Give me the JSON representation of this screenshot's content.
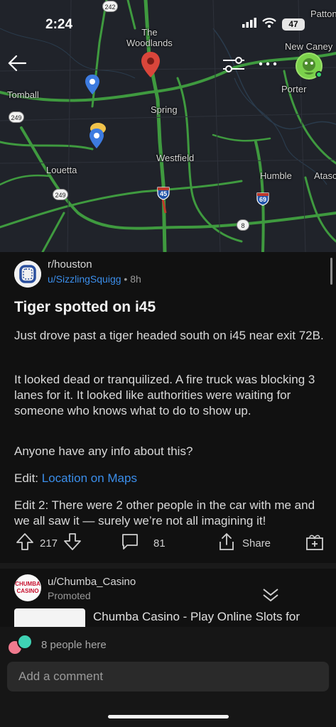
{
  "status_bar": {
    "time": "2:24",
    "battery": "47"
  },
  "map": {
    "labels": {
      "the_woodlands": "The\nWoodlands",
      "new_caney": "New Caney",
      "patton": "Patton",
      "tomball": "Tomball",
      "porter": "Porter",
      "spring": "Spring",
      "westfield": "Westfield",
      "louetta": "Louetta",
      "humble": "Humble",
      "atascocita": "Atasc"
    },
    "shields": {
      "s242": "242",
      "s249a": "249",
      "s249b": "249",
      "i45": "45",
      "i69": "69",
      "s8": "8"
    }
  },
  "post": {
    "subreddit": "r/houston",
    "author": "u/SizzlingSquigg",
    "separator": "•",
    "age": "8h",
    "title": "Tiger spotted on i45",
    "paragraphs": {
      "p1": "Just drove past a tiger headed south on i45 near exit 72B.",
      "p2": "It looked dead or tranquilized. A fire truck was blocking 3 lanes for it. It looked like authorities were waiting for someone who knows what to do to show up.",
      "p3": "Anyone have any info about this?",
      "p4_prefix": "Edit: ",
      "p4_link": "Location on Maps",
      "p5": "Edit 2: There were 2 other people in the car with me and we all saw it — surely we’re not all imagining it!"
    },
    "votes": "217",
    "comments": "81",
    "share_label": "Share"
  },
  "ad": {
    "logo_text": "CHUMBA CASINO",
    "user": "u/Chumba_Casino",
    "promoted": "Promoted",
    "title": "Chumba Casino - Play Online Slots for"
  },
  "bottom": {
    "presence": "8 people here",
    "comment_placeholder": "Add a comment"
  },
  "colors": {
    "accent_link": "#3b8eea",
    "map_road": "#3f9a3f",
    "background": "#111111"
  }
}
